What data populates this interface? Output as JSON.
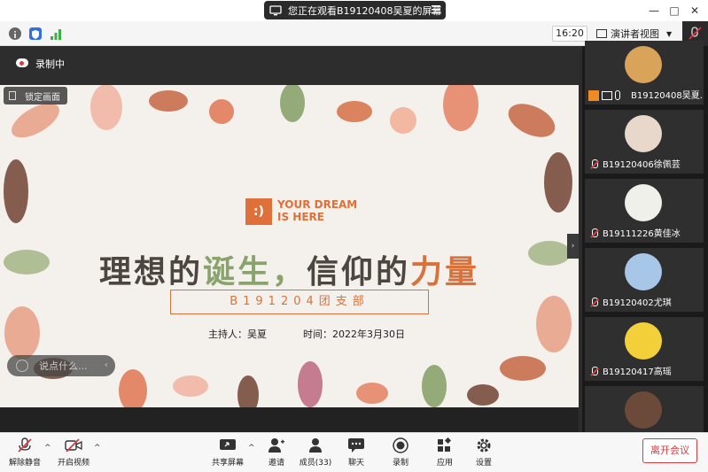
{
  "window": {
    "share_banner": "您正在观看B19120408吴夏的屏幕",
    "controls": {
      "minimize": "—",
      "restore": "□",
      "close": "✕"
    }
  },
  "toolbar": {
    "clock": "16:20",
    "view_mode": "演讲者视图",
    "icons": [
      "info-icon",
      "shield-icon",
      "signal-icon"
    ]
  },
  "stage": {
    "recording_label": "录制中",
    "lock_screen_label": "锁定画面",
    "say_something_placeholder": "说点什么...",
    "slide": {
      "logo_mark": ":)",
      "logo_line1": "YOUR DREAM",
      "logo_line2": "IS HERE",
      "title_part1": "理想的",
      "title_part2": "诞生，",
      "title_part3": "信仰的",
      "title_part4": "力量",
      "subtitle": "B191204团支部",
      "host": "主持人：吴夏",
      "time": "时间：2022年3月30日"
    }
  },
  "participants": [
    {
      "name": "B19120408吴夏...",
      "avatar_color": "#d9a35a"
    },
    {
      "name": "B19120406徐佩芸",
      "avatar_color": "#e8d8cc"
    },
    {
      "name": "B19111226黄佳冰",
      "avatar_color": "#f0f0ea"
    },
    {
      "name": "B19120402尤琪",
      "avatar_color": "#a8c6e8"
    },
    {
      "name": "B19120417高瑶",
      "avatar_color": "#f3cf3a"
    },
    {
      "name": "",
      "avatar_color": "#6b4a3a"
    }
  ],
  "bottombar": {
    "unmute": "解除静音",
    "start_video": "开启视频",
    "share_screen": "共享屏幕",
    "invite": "邀请",
    "members": "成员(33)",
    "chat": "聊天",
    "record": "录制",
    "apps": "应用",
    "settings": "设置",
    "leave": "离开会议"
  },
  "colors": {
    "accent_orange": "#d9713b",
    "leave_red": "#e0383e",
    "title_green": "#8aa36c"
  }
}
